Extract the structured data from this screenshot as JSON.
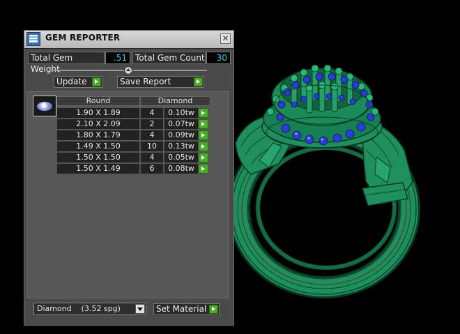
{
  "window": {
    "title": "GEM REPORTER",
    "close_glyph": "✕"
  },
  "summary": {
    "weight_label": "Total Gem Weight",
    "weight_value": ".51",
    "count_label": "Total Gem Count",
    "count_value": "30"
  },
  "actions": {
    "update_label": "Update",
    "save_report_label": "Save Report"
  },
  "gem_list": {
    "shape_header": "Round",
    "material_header": "Diamond",
    "rows": [
      {
        "size": "1.90 X 1.89",
        "count": "4",
        "weight": "0.10tw"
      },
      {
        "size": "2.10 X 2.09",
        "count": "2",
        "weight": "0.07tw"
      },
      {
        "size": "1.80 X 1.79",
        "count": "4",
        "weight": "0.09tw"
      },
      {
        "size": "1.49 X 1.50",
        "count": "10",
        "weight": "0.13tw"
      },
      {
        "size": "1.50 X 1.50",
        "count": "4",
        "weight": "0.05tw"
      },
      {
        "size": "1.50 X 1.49",
        "count": "6",
        "weight": "0.08tw"
      }
    ]
  },
  "material": {
    "selected": "Diamond    (3.52 spg)",
    "set_label": "Set Material"
  },
  "icons": {
    "app": "gem-reporter-app-icon",
    "gem": "round-gem-icon",
    "go": "green-arrow-icon",
    "dropdown": "chevron-down-icon"
  },
  "colors": {
    "ring_body": "#1f8a5c",
    "ring_edge": "#0d3a26",
    "gem_blue": "#2a3fd0",
    "value_text": "#36c8e8",
    "go_button": "#4cab2b"
  }
}
